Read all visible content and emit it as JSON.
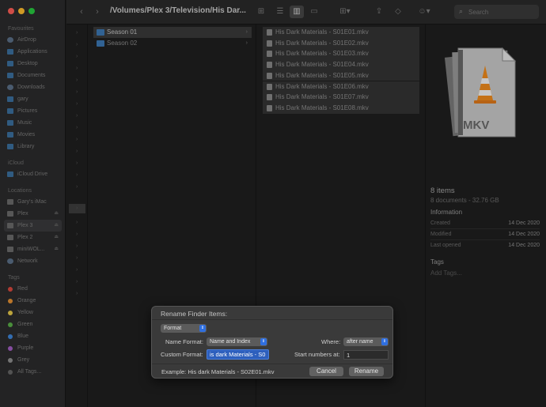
{
  "toolbar": {
    "back": "‹",
    "forward": "›",
    "path": "/Volumes/Plex 3/Television/His Dar...",
    "search_placeholder": "Search"
  },
  "sidebar": {
    "favourites_header": "Favourites",
    "favourites": [
      "AirDrop",
      "Applications",
      "Desktop",
      "Documents",
      "Downloads",
      "gary",
      "Pictures",
      "Music",
      "Movies",
      "Library"
    ],
    "icloud_header": "iCloud",
    "icloud": [
      "iCloud Drive"
    ],
    "locations_header": "Locations",
    "locations": [
      "Gary's iMac",
      "Plex",
      "Plex 3",
      "Plex 2",
      "miniWOL...",
      "Network"
    ],
    "tags_header": "Tags",
    "tags": [
      {
        "label": "Red",
        "color": "#d8483f"
      },
      {
        "label": "Orange",
        "color": "#e39134"
      },
      {
        "label": "Yellow",
        "color": "#e6c84a"
      },
      {
        "label": "Green",
        "color": "#5aae48"
      },
      {
        "label": "Blue",
        "color": "#3f86d8"
      },
      {
        "label": "Purple",
        "color": "#a35ec4"
      },
      {
        "label": "Grey",
        "color": "#8e8e8e"
      }
    ],
    "all_tags": "All Tags..."
  },
  "column1": [
    "Season 01",
    "Season 02"
  ],
  "column2": [
    "His Dark Materials - S01E01.mkv",
    "His Dark Materials - S01E02.mkv",
    "His Dark Materials - S01E03.mkv",
    "His Dark Materials - S01E04.mkv",
    "His Dark Materials - S01E05.mkv",
    "His Dark Materials - S01E06.mkv",
    "His Dark Materials - S01E07.mkv",
    "His Dark Materials - S01E08.mkv"
  ],
  "preview": {
    "badge": "MKV",
    "count": "8 items",
    "subtitle": "8 documents - 32.76 GB",
    "info_header": "Information",
    "created_label": "Created",
    "created_value": "14 Dec 2020",
    "modified_label": "Modified",
    "modified_value": "14 Dec 2020",
    "opened_label": "Last opened",
    "opened_value": "14 Dec 2020",
    "tags_header": "Tags",
    "tags_placeholder": "Add Tags..."
  },
  "dialog": {
    "title": "Rename Finder Items:",
    "mode": "Format",
    "name_format_label": "Name Format:",
    "name_format_value": "Name and Index",
    "where_label": "Where:",
    "where_value": "after name",
    "custom_format_label": "Custom Format:",
    "custom_format_value": "is dark Materials - S0",
    "start_label": "Start numbers at:",
    "start_value": "1",
    "example": "Example: His dark Materials - S02E01.mkv",
    "cancel": "Cancel",
    "rename": "Rename"
  }
}
